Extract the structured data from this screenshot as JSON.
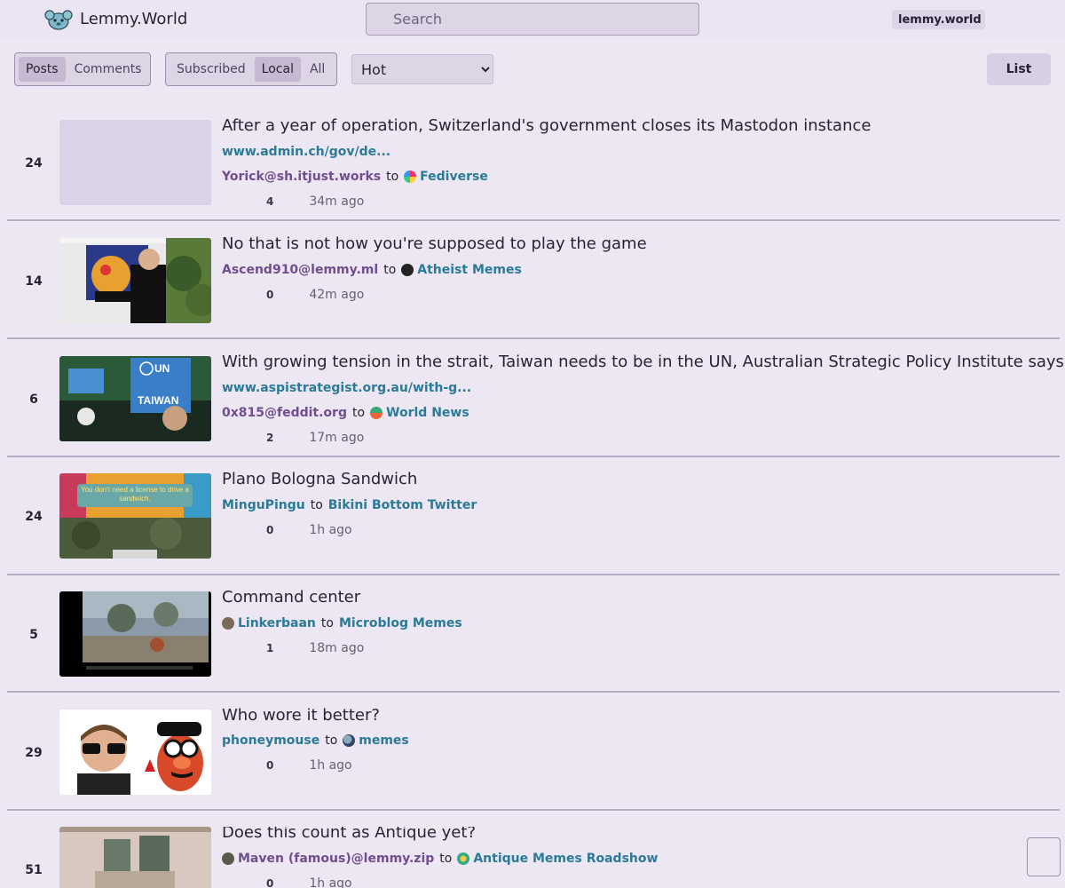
{
  "nav": {
    "menu_icon": "",
    "site_title": "Lemmy.World",
    "search_icon": "",
    "search_placeholder": "Search",
    "instance_icon": "",
    "instance_label": "lemmy.world",
    "icon_a": "",
    "icon_b": ""
  },
  "filters": {
    "type_tabs": [
      {
        "label": "Posts",
        "active": true
      },
      {
        "label": "Comments",
        "active": false
      }
    ],
    "listing_tabs": [
      {
        "label": "Subscribed",
        "active": false
      },
      {
        "label": "Local",
        "active": true
      },
      {
        "label": "All",
        "active": false
      }
    ],
    "sort_selected": "Hot",
    "view_label": "List",
    "view_icon_left": "",
    "view_icon_right": ""
  },
  "posts": [
    {
      "score": "24",
      "title": "After a year of operation, Switzerland's government closes its Mastodon instance",
      "url_icon": "",
      "url": "www.admin.ch/gov/de...",
      "author": "Yorick@sh.itjust.works",
      "to": "to",
      "community": "Fediverse",
      "comments": "4",
      "time": "34m ago",
      "thumb_icon": ""
    },
    {
      "score": "14",
      "title": "No that is not how you're supposed to play the game",
      "author": "Ascend910@lemmy.ml",
      "to": "to",
      "community": "Atheist Memes",
      "comments": "0",
      "time": "42m ago"
    },
    {
      "score": "6",
      "title": "With growing tension in the strait, Taiwan needs to be in the UN, Australian Strategic Policy Institute says",
      "url_icon": "",
      "url": "www.aspistrategist.org.au/with-g...",
      "author": "0x815@feddit.org",
      "to": "to",
      "community": "World News",
      "comments": "2",
      "time": "17m ago",
      "thumb_sign_top": "UN",
      "thumb_sign_bottom": "TAIWAN"
    },
    {
      "score": "24",
      "title": "Plano Bologna Sandwich",
      "author": "MinguPingu",
      "to": "to",
      "community": "Bikini Bottom Twitter",
      "comments": "0",
      "time": "1h ago",
      "thumb_caption": "You don't need a license to drive a sandwich."
    },
    {
      "score": "5",
      "title": "Command center",
      "author": "Linkerbaan",
      "to": "to",
      "community": "Microblog Memes",
      "comments": "1",
      "time": "18m ago"
    },
    {
      "score": "29",
      "title": "Who wore it better?",
      "author": "phoneymouse",
      "to": "to",
      "community": "memes",
      "comments": "0",
      "time": "1h ago"
    },
    {
      "score": "51",
      "title": "Does this count as Antique yet?",
      "author": "Maven (famous)@lemmy.zip",
      "to": "to",
      "community": "Antique Memes Roadshow",
      "comments": "0",
      "time": "1h ago"
    }
  ],
  "post_icons": {
    "upvote": "",
    "downvote": "",
    "comment": "",
    "more": ""
  },
  "scroll_top_icon": "",
  "colors": {
    "background": "#ede7f3",
    "link": "#2a7a98",
    "author_purple": "#6f4e8f",
    "active_tab": "#c6bad3"
  }
}
